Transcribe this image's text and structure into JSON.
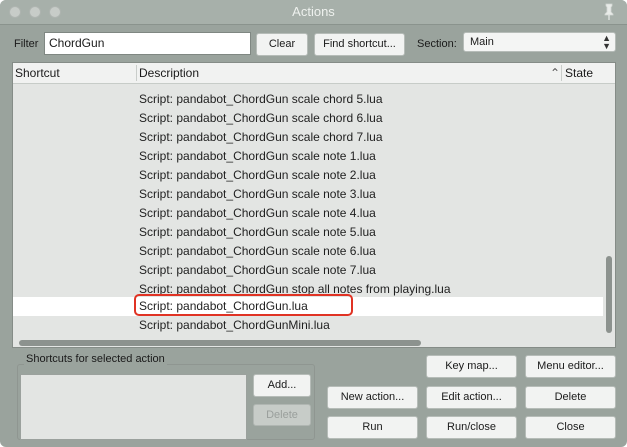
{
  "window": {
    "title": "Actions"
  },
  "filter": {
    "label": "Filter",
    "value": "ChordGun"
  },
  "buttons": {
    "clear": "Clear",
    "find_shortcut": "Find shortcut...",
    "add": "Add...",
    "delete_shortcut": "Delete",
    "key_map": "Key map...",
    "menu_editor": "Menu editor...",
    "new_action": "New action...",
    "edit_action": "Edit action...",
    "delete_action": "Delete",
    "run": "Run",
    "run_close": "Run/close",
    "close": "Close"
  },
  "section": {
    "label": "Section:",
    "value": "Main"
  },
  "columns": {
    "shortcut": "Shortcut",
    "description": "Description",
    "state": "State"
  },
  "rows": [
    "Script: pandabot_ChordGun scale chord 5.lua",
    "Script: pandabot_ChordGun scale chord 6.lua",
    "Script: pandabot_ChordGun scale chord 7.lua",
    "Script: pandabot_ChordGun scale note 1.lua",
    "Script: pandabot_ChordGun scale note 2.lua",
    "Script: pandabot_ChordGun scale note 3.lua",
    "Script: pandabot_ChordGun scale note 4.lua",
    "Script: pandabot_ChordGun scale note 5.lua",
    "Script: pandabot_ChordGun scale note 6.lua",
    "Script: pandabot_ChordGun scale note 7.lua",
    "Script: pandabot_ChordGun stop all notes from playing.lua",
    "Script: pandabot_ChordGun.lua",
    "Script: pandabot_ChordGunMini.lua"
  ],
  "selected_row_index": 11,
  "shortcuts_panel": {
    "title": "Shortcuts for selected action"
  },
  "colors": {
    "highlight": "#e03324",
    "window_bg": "#9aa39d",
    "list_bg": "#e3e5e3"
  }
}
